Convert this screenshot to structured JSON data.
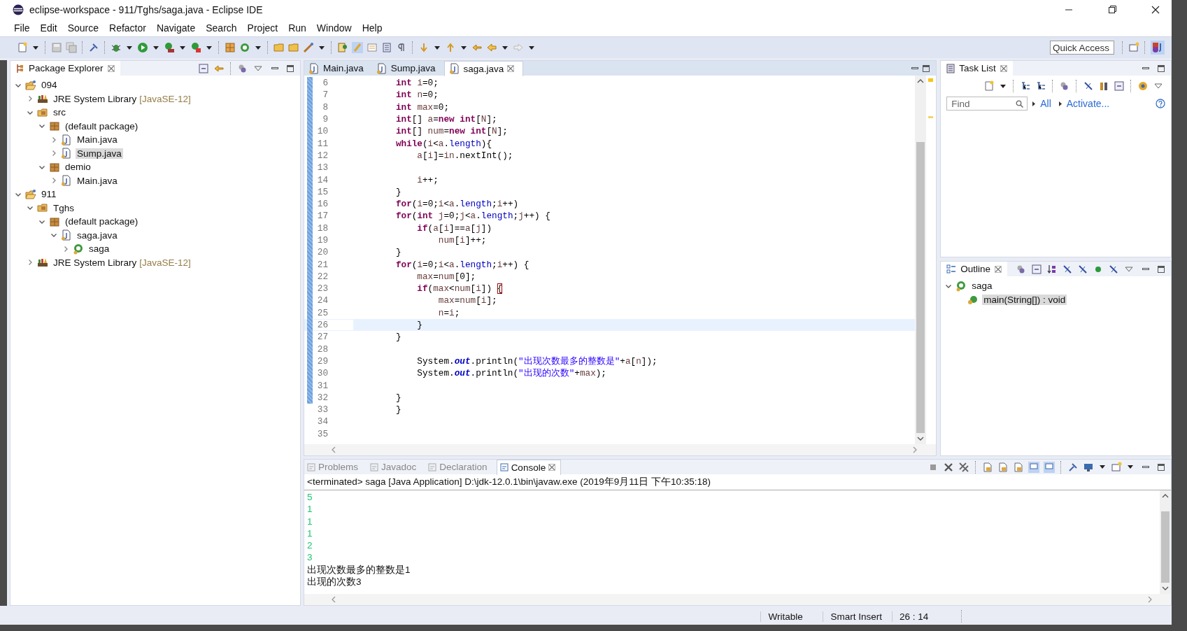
{
  "window": {
    "title": "eclipse-workspace - 911/Tghs/saga.java - Eclipse IDE"
  },
  "menu": [
    "File",
    "Edit",
    "Source",
    "Refactor",
    "Navigate",
    "Search",
    "Project",
    "Run",
    "Window",
    "Help"
  ],
  "quick_access": {
    "placeholder": "Quick Access"
  },
  "package_explorer": {
    "title": "Package Explorer",
    "items": [
      {
        "label": "094",
        "kind": "project",
        "expanded": true,
        "selected": false,
        "children": [
          {
            "label": "JRE System Library",
            "decoration": "[JavaSE-12]",
            "kind": "library",
            "expanded": false,
            "selected": false
          },
          {
            "label": "src",
            "kind": "source-folder",
            "expanded": true,
            "selected": false,
            "children": [
              {
                "label": "(default package)",
                "kind": "package",
                "expanded": true,
                "selected": false,
                "children": [
                  {
                    "label": "Main.java",
                    "kind": "java-file",
                    "expanded": false,
                    "selected": false
                  },
                  {
                    "label": "Sump.java",
                    "kind": "java-file",
                    "expanded": false,
                    "selected": true
                  }
                ]
              },
              {
                "label": "demio",
                "kind": "package",
                "expanded": true,
                "selected": false,
                "children": [
                  {
                    "label": "Main.java",
                    "kind": "java-file",
                    "expanded": false,
                    "selected": false
                  }
                ]
              }
            ]
          }
        ]
      },
      {
        "label": "911",
        "kind": "project",
        "expanded": true,
        "selected": false,
        "children": [
          {
            "label": "Tghs",
            "kind": "source-folder",
            "expanded": true,
            "selected": false,
            "children": [
              {
                "label": "(default package)",
                "kind": "package",
                "expanded": true,
                "selected": false,
                "children": [
                  {
                    "label": "saga.java",
                    "kind": "java-file",
                    "expanded": true,
                    "selected": false,
                    "children": [
                      {
                        "label": "saga",
                        "kind": "class",
                        "expanded": false,
                        "selected": false
                      }
                    ]
                  }
                ]
              }
            ]
          },
          {
            "label": "JRE System Library",
            "decoration": "[JavaSE-12]",
            "kind": "library",
            "expanded": false,
            "selected": false
          }
        ]
      }
    ]
  },
  "editor": {
    "tabs": [
      {
        "label": "Main.java",
        "selected": false
      },
      {
        "label": "Sump.java",
        "selected": false
      },
      {
        "label": "saga.java",
        "selected": true
      }
    ],
    "lines": [
      {
        "number": "6",
        "changed": true,
        "current": false,
        "segments": [
          {
            "text": "        int ",
            "kind": "keyword"
          },
          {
            "text": "i",
            "kind": "variable"
          },
          {
            "text": "=0;",
            "kind": "plain"
          }
        ]
      },
      {
        "number": "7",
        "changed": true,
        "current": false,
        "segments": [
          {
            "text": "        int ",
            "kind": "keyword"
          },
          {
            "text": "n",
            "kind": "variable"
          },
          {
            "text": "=0;",
            "kind": "plain"
          }
        ]
      },
      {
        "number": "8",
        "changed": true,
        "current": false,
        "segments": [
          {
            "text": "        int ",
            "kind": "keyword"
          },
          {
            "text": "max",
            "kind": "variable"
          },
          {
            "text": "=0;",
            "kind": "plain"
          }
        ]
      },
      {
        "number": "9",
        "changed": true,
        "current": false,
        "segments": [
          {
            "text": "        int",
            "kind": "keyword"
          },
          {
            "text": "[] ",
            "kind": "plain"
          },
          {
            "text": "a",
            "kind": "variable"
          },
          {
            "text": "=",
            "kind": "plain"
          },
          {
            "text": "new int",
            "kind": "keyword"
          },
          {
            "text": "[",
            "kind": "plain"
          },
          {
            "text": "N",
            "kind": "variable"
          },
          {
            "text": "];",
            "kind": "plain"
          }
        ]
      },
      {
        "number": "10",
        "changed": true,
        "current": false,
        "segments": [
          {
            "text": "        int",
            "kind": "keyword"
          },
          {
            "text": "[] ",
            "kind": "plain"
          },
          {
            "text": "num",
            "kind": "variable"
          },
          {
            "text": "=",
            "kind": "plain"
          },
          {
            "text": "new int",
            "kind": "keyword"
          },
          {
            "text": "[",
            "kind": "plain"
          },
          {
            "text": "N",
            "kind": "variable"
          },
          {
            "text": "];",
            "kind": "plain"
          }
        ]
      },
      {
        "number": "11",
        "changed": true,
        "current": false,
        "segments": [
          {
            "text": "        while",
            "kind": "keyword"
          },
          {
            "text": "(",
            "kind": "plain"
          },
          {
            "text": "i",
            "kind": "variable"
          },
          {
            "text": "<",
            "kind": "plain"
          },
          {
            "text": "a",
            "kind": "variable"
          },
          {
            "text": ".",
            "kind": "plain"
          },
          {
            "text": "length",
            "kind": "field"
          },
          {
            "text": "){",
            "kind": "plain"
          }
        ]
      },
      {
        "number": "12",
        "changed": true,
        "current": false,
        "segments": [
          {
            "text": "            a",
            "kind": "variable"
          },
          {
            "text": "[",
            "kind": "plain"
          },
          {
            "text": "i",
            "kind": "variable"
          },
          {
            "text": "]=",
            "kind": "plain"
          },
          {
            "text": "in",
            "kind": "variable"
          },
          {
            "text": ".nextInt();",
            "kind": "plain"
          }
        ]
      },
      {
        "number": "13",
        "changed": true,
        "current": false
      },
      {
        "number": "14",
        "changed": true,
        "current": false,
        "segments": [
          {
            "text": "            i",
            "kind": "variable"
          },
          {
            "text": "++;",
            "kind": "plain"
          }
        ]
      },
      {
        "number": "15",
        "changed": true,
        "current": false,
        "segments": [
          {
            "text": "        }",
            "kind": "plain"
          }
        ]
      },
      {
        "number": "16",
        "changed": true,
        "current": false,
        "segments": [
          {
            "text": "        for",
            "kind": "keyword"
          },
          {
            "text": "(",
            "kind": "plain"
          },
          {
            "text": "i",
            "kind": "variable"
          },
          {
            "text": "=0;",
            "kind": "plain"
          },
          {
            "text": "i",
            "kind": "variable"
          },
          {
            "text": "<",
            "kind": "plain"
          },
          {
            "text": "a",
            "kind": "variable"
          },
          {
            "text": ".",
            "kind": "plain"
          },
          {
            "text": "length",
            "kind": "field"
          },
          {
            "text": ";",
            "kind": "plain"
          },
          {
            "text": "i",
            "kind": "variable"
          },
          {
            "text": "++)",
            "kind": "plain"
          }
        ]
      },
      {
        "number": "17",
        "changed": true,
        "current": false,
        "segments": [
          {
            "text": "        for",
            "kind": "keyword"
          },
          {
            "text": "(",
            "kind": "plain"
          },
          {
            "text": "int ",
            "kind": "keyword"
          },
          {
            "text": "j",
            "kind": "variable"
          },
          {
            "text": "=0;",
            "kind": "plain"
          },
          {
            "text": "j",
            "kind": "variable"
          },
          {
            "text": "<",
            "kind": "plain"
          },
          {
            "text": "a",
            "kind": "variable"
          },
          {
            "text": ".",
            "kind": "plain"
          },
          {
            "text": "length",
            "kind": "field"
          },
          {
            "text": ";",
            "kind": "plain"
          },
          {
            "text": "j",
            "kind": "variable"
          },
          {
            "text": "++) {",
            "kind": "plain"
          }
        ]
      },
      {
        "number": "18",
        "changed": true,
        "current": false,
        "segments": [
          {
            "text": "            if",
            "kind": "keyword"
          },
          {
            "text": "(",
            "kind": "plain"
          },
          {
            "text": "a",
            "kind": "variable"
          },
          {
            "text": "[",
            "kind": "plain"
          },
          {
            "text": "i",
            "kind": "variable"
          },
          {
            "text": "]==",
            "kind": "plain"
          },
          {
            "text": "a",
            "kind": "variable"
          },
          {
            "text": "[",
            "kind": "plain"
          },
          {
            "text": "j",
            "kind": "variable"
          },
          {
            "text": "])",
            "kind": "plain"
          }
        ]
      },
      {
        "number": "19",
        "changed": true,
        "current": false,
        "segments": [
          {
            "text": "                num",
            "kind": "variable"
          },
          {
            "text": "[",
            "kind": "plain"
          },
          {
            "text": "i",
            "kind": "variable"
          },
          {
            "text": "]++;",
            "kind": "plain"
          }
        ]
      },
      {
        "number": "20",
        "changed": true,
        "current": false,
        "segments": [
          {
            "text": "        }",
            "kind": "plain"
          }
        ]
      },
      {
        "number": "21",
        "changed": true,
        "current": false,
        "segments": [
          {
            "text": "        for",
            "kind": "keyword"
          },
          {
            "text": "(",
            "kind": "plain"
          },
          {
            "text": "i",
            "kind": "variable"
          },
          {
            "text": "=0;",
            "kind": "plain"
          },
          {
            "text": "i",
            "kind": "variable"
          },
          {
            "text": "<",
            "kind": "plain"
          },
          {
            "text": "a",
            "kind": "variable"
          },
          {
            "text": ".",
            "kind": "plain"
          },
          {
            "text": "length",
            "kind": "field"
          },
          {
            "text": ";",
            "kind": "plain"
          },
          {
            "text": "i",
            "kind": "variable"
          },
          {
            "text": "++) {",
            "kind": "plain"
          }
        ]
      },
      {
        "number": "22",
        "changed": true,
        "current": false,
        "segments": [
          {
            "text": "            max",
            "kind": "variable"
          },
          {
            "text": "=",
            "kind": "plain"
          },
          {
            "text": "num",
            "kind": "variable"
          },
          {
            "text": "[0];",
            "kind": "plain"
          }
        ]
      },
      {
        "number": "23",
        "changed": true,
        "current": false,
        "segments": [
          {
            "text": "            if",
            "kind": "keyword"
          },
          {
            "text": "(",
            "kind": "plain"
          },
          {
            "text": "max",
            "kind": "variable"
          },
          {
            "text": "<",
            "kind": "plain"
          },
          {
            "text": "num",
            "kind": "variable"
          },
          {
            "text": "[",
            "kind": "plain"
          },
          {
            "text": "i",
            "kind": "variable"
          },
          {
            "text": "]) ",
            "kind": "plain"
          },
          {
            "text": "{",
            "kind": "matching-bracket"
          }
        ]
      },
      {
        "number": "24",
        "changed": true,
        "current": false,
        "segments": [
          {
            "text": "                max",
            "kind": "variable"
          },
          {
            "text": "=",
            "kind": "plain"
          },
          {
            "text": "num",
            "kind": "variable"
          },
          {
            "text": "[",
            "kind": "plain"
          },
          {
            "text": "i",
            "kind": "variable"
          },
          {
            "text": "];",
            "kind": "plain"
          }
        ]
      },
      {
        "number": "25",
        "changed": true,
        "current": false,
        "segments": [
          {
            "text": "                n",
            "kind": "variable"
          },
          {
            "text": "=",
            "kind": "plain"
          },
          {
            "text": "i",
            "kind": "variable"
          },
          {
            "text": ";",
            "kind": "plain"
          }
        ]
      },
      {
        "number": "26",
        "changed": true,
        "current": true,
        "segments": [
          {
            "text": "            }",
            "kind": "plain"
          }
        ]
      },
      {
        "number": "27",
        "changed": true,
        "current": false,
        "segments": [
          {
            "text": "        }",
            "kind": "plain"
          }
        ]
      },
      {
        "number": "28",
        "changed": true,
        "current": false
      },
      {
        "number": "29",
        "changed": true,
        "current": false,
        "segments": [
          {
            "text": "            System.",
            "kind": "plain"
          },
          {
            "text": "out",
            "kind": "static-field"
          },
          {
            "text": ".println(",
            "kind": "plain"
          },
          {
            "text": "\"出现次数最多的整数是\"",
            "kind": "string"
          },
          {
            "text": "+",
            "kind": "plain"
          },
          {
            "text": "a",
            "kind": "variable"
          },
          {
            "text": "[",
            "kind": "plain"
          },
          {
            "text": "n",
            "kind": "variable"
          },
          {
            "text": "]);",
            "kind": "plain"
          }
        ]
      },
      {
        "number": "30",
        "changed": true,
        "current": false,
        "segments": [
          {
            "text": "            System.",
            "kind": "plain"
          },
          {
            "text": "out",
            "kind": "static-field"
          },
          {
            "text": ".println(",
            "kind": "plain"
          },
          {
            "text": "\"出现的次数\"",
            "kind": "string"
          },
          {
            "text": "+",
            "kind": "plain"
          },
          {
            "text": "max",
            "kind": "variable"
          },
          {
            "text": ");",
            "kind": "plain"
          }
        ]
      },
      {
        "number": "31",
        "changed": true,
        "current": false
      },
      {
        "number": "32",
        "changed": true,
        "current": false,
        "segments": [
          {
            "text": "        }",
            "kind": "plain"
          }
        ]
      },
      {
        "number": "33",
        "changed": false,
        "current": false,
        "segments": [
          {
            "text": "        }",
            "kind": "plain"
          }
        ]
      },
      {
        "number": "34",
        "changed": false,
        "current": false
      },
      {
        "number": "35",
        "changed": false,
        "current": false
      }
    ]
  },
  "task_list": {
    "title": "Task List",
    "find": {
      "placeholder": "Find"
    },
    "links": [
      "All",
      "Activate..."
    ]
  },
  "outline": {
    "title": "Outline",
    "items": [
      {
        "label": "saga",
        "kind": "class",
        "expanded": true,
        "selected": false,
        "children": [
          {
            "label": "main(String[]) : void",
            "kind": "method",
            "selected": true
          }
        ]
      }
    ]
  },
  "console": {
    "tabs": [
      {
        "label": "Problems",
        "selected": false
      },
      {
        "label": "Javadoc",
        "selected": false
      },
      {
        "label": "Declaration",
        "selected": false
      },
      {
        "label": "Console",
        "selected": true
      }
    ],
    "header": "<terminated> saga [Java Application] D:\\jdk-12.0.1\\bin\\javaw.exe (2019年9月11日 下午10:35:18)",
    "lines": [
      {
        "text": "5",
        "kind": "input"
      },
      {
        "text": "1",
        "kind": "input"
      },
      {
        "text": "1",
        "kind": "input"
      },
      {
        "text": "1",
        "kind": "input"
      },
      {
        "text": "2",
        "kind": "input"
      },
      {
        "text": "3",
        "kind": "input"
      },
      {
        "text": "出现次数最多的整数是1",
        "kind": "output"
      },
      {
        "text": "出现的次数3",
        "kind": "output"
      }
    ]
  },
  "status_bar": [
    "Writable",
    "Smart Insert",
    "26 : 14"
  ]
}
